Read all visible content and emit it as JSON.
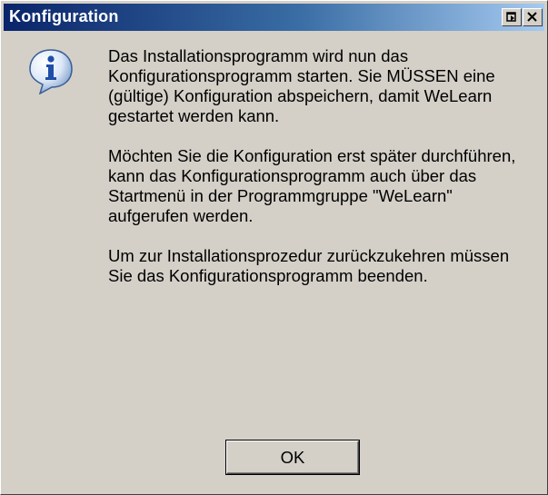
{
  "window": {
    "title": "Konfiguration"
  },
  "titlebar_buttons": {
    "help_icon": "help-restore-icon",
    "close_icon": "close-icon"
  },
  "dialog": {
    "icon": "info-icon",
    "paragraphs": [
      "Das Installationsprogramm wird nun das Konfigurationsprogramm starten. Sie MÜSSEN eine (gültige) Konfiguration abspeichern, damit WeLearn gestartet werden kann.",
      "Möchten Sie die Konfiguration erst später durchführen, kann das Konfigurationsprogramm auch über das Startmenü in der Programmgruppe \"WeLearn\" aufgerufen werden.",
      "Um zur Installationsprozedur zurückzukehren müssen Sie das Konfigurationsprogramm beenden."
    ],
    "ok_label": "OK"
  },
  "colors": {
    "titlebar_start": "#0a246a",
    "titlebar_end": "#a6caf0",
    "face": "#d4d0c8"
  }
}
